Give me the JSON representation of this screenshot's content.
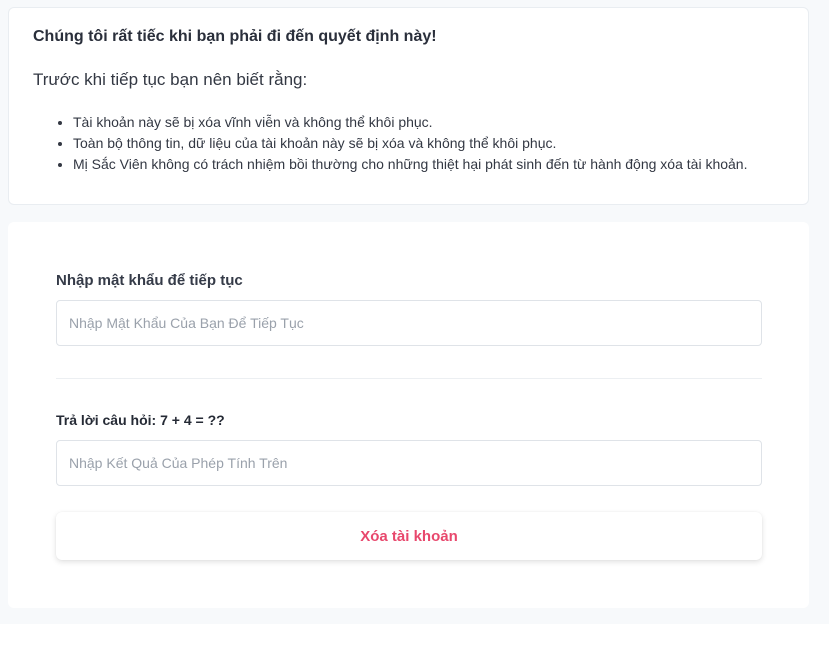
{
  "warning": {
    "title": "Chúng tôi rất tiếc khi bạn phải đi đến quyết định này!",
    "subtitle": "Trước khi tiếp tục bạn nên biết rằng:",
    "items": [
      "Tài khoản này sẽ bị xóa vĩnh viễn và không thể khôi phục.",
      "Toàn bộ thông tin, dữ liệu của tài khoản này sẽ bị xóa và không thể khôi phục.",
      "Mị Sắc Viên không có trách nhiệm bồi thường cho những thiệt hại phát sinh đến từ hành động xóa tài khoản."
    ]
  },
  "form": {
    "password_label": "Nhập mật khẩu để tiếp tục",
    "password_placeholder": "Nhập Mật Khẩu Của Bạn Để Tiếp Tục",
    "password_value": "",
    "captcha_label": "Trả lời câu hỏi: 7 + 4 = ??",
    "captcha_placeholder": "Nhập Kết Quả Của Phép Tính Trên",
    "captcha_value": "",
    "submit_label": "Xóa tài khoản"
  },
  "colors": {
    "accent": "#e8486d",
    "background": "#f7f9fb",
    "card": "#ffffff"
  }
}
